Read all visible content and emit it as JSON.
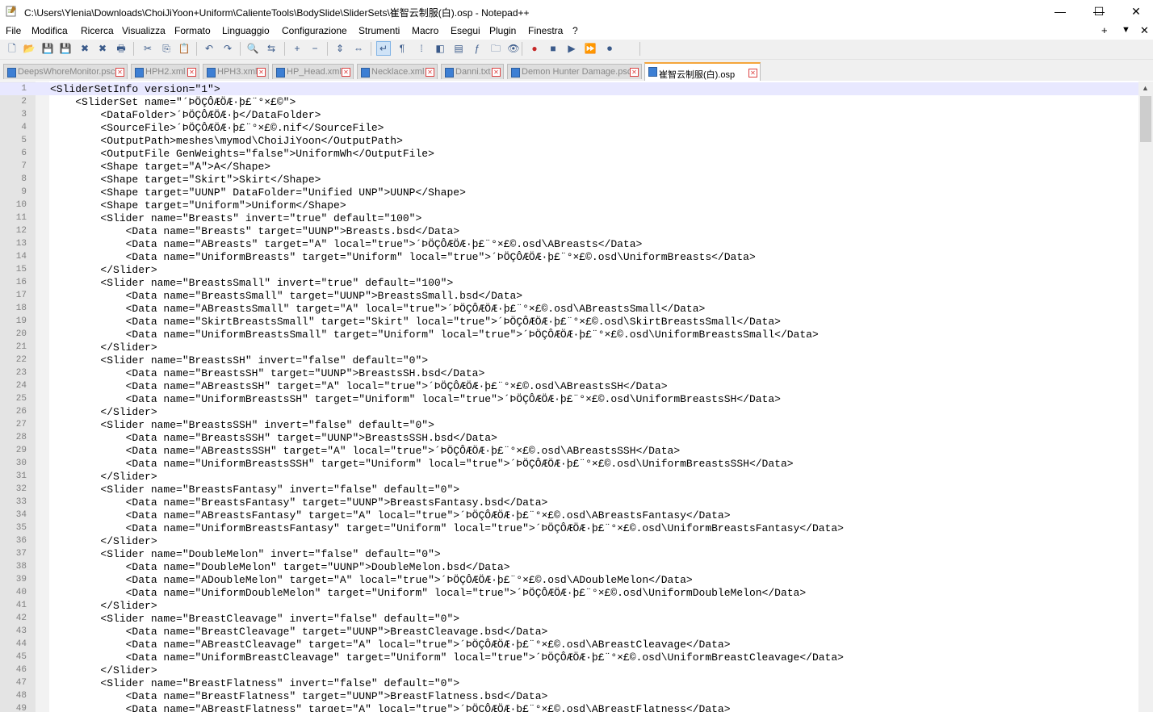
{
  "window": {
    "title": "C:\\Users\\Ylenia\\Downloads\\ChoiJiYoon+Uniform\\CalienteTools\\BodySlide\\SliderSets\\崔智云制服(白).osp - Notepad++",
    "min_label": "—",
    "max_label": "☐",
    "close_label": "✕"
  },
  "menu": {
    "items": [
      "File",
      "Modifica",
      "Ricerca",
      "Visualizza",
      "Formato",
      "Linguaggio",
      "Configurazione",
      "Strumenti",
      "Macro",
      "Esegui",
      "Plugin",
      "Finestra",
      "?"
    ],
    "right": [
      "+",
      "▼",
      "✕"
    ]
  },
  "toolbar": {
    "icons": [
      "new-file-icon",
      "open-file-icon",
      "save-icon",
      "save-all-icon",
      "close-icon",
      "close-all-icon",
      "print-icon",
      "cut-icon",
      "copy-icon",
      "paste-icon",
      "undo-icon",
      "redo-icon",
      "find-icon",
      "replace-icon",
      "zoom-in-icon",
      "zoom-out-icon",
      "sync-vertical-icon",
      "sync-horizontal-icon",
      "word-wrap-icon",
      "show-all-chars-icon",
      "indent-guide-icon",
      "language-icon",
      "doc-map-icon",
      "function-list-icon",
      "folder-workspace-icon",
      "monitoring-icon",
      "record-macro-icon",
      "stop-record-icon",
      "play-macro-icon",
      "run-macro-multiple-icon",
      "save-macro-icon"
    ],
    "glyphs": [
      "🗋",
      "📂",
      "💾",
      "💾",
      "✖",
      "✖",
      "🖶",
      "✂",
      "⎘",
      "📋",
      "↶",
      "↷",
      "🔍",
      "⇆",
      "+",
      "−",
      "⇕",
      "⇔",
      "↵",
      "¶",
      "⁞",
      "◧",
      "▤",
      "ƒ",
      "🗀",
      "👁",
      "●",
      "■",
      "▶",
      "⏩",
      "⏺"
    ]
  },
  "tabs": [
    {
      "label": "DeepsWhoreMonitor.psc",
      "active": false
    },
    {
      "label": "HPH2.xml",
      "active": false
    },
    {
      "label": "HPH3.xml",
      "active": false
    },
    {
      "label": "HP_Head.xml",
      "active": false
    },
    {
      "label": "Necklace.xml",
      "active": false
    },
    {
      "label": "Danni.txt",
      "active": false
    },
    {
      "label": "Demon Hunter Damage.psc",
      "active": false
    },
    {
      "label": "崔智云制服(白).osp",
      "active": true
    }
  ],
  "editor": {
    "current_line": 1,
    "lines": [
      {
        "n": "1",
        "text": "<SliderSetInfo version=\"1\">"
      },
      {
        "n": "2",
        "text": "    <SliderSet name=\"´ÞÖÇÔÆÖÆ·þ£¨°×£©\">"
      },
      {
        "n": "3",
        "text": "        <DataFolder>´ÞÖÇÔÆÖÆ·þ</DataFolder>"
      },
      {
        "n": "4",
        "text": "        <SourceFile>´ÞÖÇÔÆÖÆ·þ£¨°×£©.nif</SourceFile>"
      },
      {
        "n": "5",
        "text": "        <OutputPath>meshes\\mymod\\ChoiJiYoon</OutputPath>"
      },
      {
        "n": "6",
        "text": "        <OutputFile GenWeights=\"false\">UniformWh</OutputFile>"
      },
      {
        "n": "7",
        "text": "        <Shape target=\"A\">A</Shape>"
      },
      {
        "n": "8",
        "text": "        <Shape target=\"Skirt\">Skirt</Shape>"
      },
      {
        "n": "9",
        "text": "        <Shape target=\"UUNP\" DataFolder=\"Unified UNP\">UUNP</Shape>"
      },
      {
        "n": "10",
        "text": "        <Shape target=\"Uniform\">Uniform</Shape>"
      },
      {
        "n": "11",
        "text": "        <Slider name=\"Breasts\" invert=\"true\" default=\"100\">"
      },
      {
        "n": "12",
        "text": "            <Data name=\"Breasts\" target=\"UUNP\">Breasts.bsd</Data>"
      },
      {
        "n": "13",
        "text": "            <Data name=\"ABreasts\" target=\"A\" local=\"true\">´ÞÖÇÔÆÖÆ·þ£¨°×£©.osd\\ABreasts</Data>"
      },
      {
        "n": "14",
        "text": "            <Data name=\"UniformBreasts\" target=\"Uniform\" local=\"true\">´ÞÖÇÔÆÖÆ·þ£¨°×£©.osd\\UniformBreasts</Data>"
      },
      {
        "n": "15",
        "text": "        </Slider>"
      },
      {
        "n": "16",
        "text": "        <Slider name=\"BreastsSmall\" invert=\"true\" default=\"100\">"
      },
      {
        "n": "17",
        "text": "            <Data name=\"BreastsSmall\" target=\"UUNP\">BreastsSmall.bsd</Data>"
      },
      {
        "n": "18",
        "text": "            <Data name=\"ABreastsSmall\" target=\"A\" local=\"true\">´ÞÖÇÔÆÖÆ·þ£¨°×£©.osd\\ABreastsSmall</Data>"
      },
      {
        "n": "19",
        "text": "            <Data name=\"SkirtBreastsSmall\" target=\"Skirt\" local=\"true\">´ÞÖÇÔÆÖÆ·þ£¨°×£©.osd\\SkirtBreastsSmall</Data>"
      },
      {
        "n": "20",
        "text": "            <Data name=\"UniformBreastsSmall\" target=\"Uniform\" local=\"true\">´ÞÖÇÔÆÖÆ·þ£¨°×£©.osd\\UniformBreastsSmall</Data>"
      },
      {
        "n": "21",
        "text": "        </Slider>"
      },
      {
        "n": "22",
        "text": "        <Slider name=\"BreastsSH\" invert=\"false\" default=\"0\">"
      },
      {
        "n": "23",
        "text": "            <Data name=\"BreastsSH\" target=\"UUNP\">BreastsSH.bsd</Data>"
      },
      {
        "n": "24",
        "text": "            <Data name=\"ABreastsSH\" target=\"A\" local=\"true\">´ÞÖÇÔÆÖÆ·þ£¨°×£©.osd\\ABreastsSH</Data>"
      },
      {
        "n": "25",
        "text": "            <Data name=\"UniformBreastsSH\" target=\"Uniform\" local=\"true\">´ÞÖÇÔÆÖÆ·þ£¨°×£©.osd\\UniformBreastsSH</Data>"
      },
      {
        "n": "26",
        "text": "        </Slider>"
      },
      {
        "n": "27",
        "text": "        <Slider name=\"BreastsSSH\" invert=\"false\" default=\"0\">"
      },
      {
        "n": "28",
        "text": "            <Data name=\"BreastsSSH\" target=\"UUNP\">BreastsSSH.bsd</Data>"
      },
      {
        "n": "29",
        "text": "            <Data name=\"ABreastsSSH\" target=\"A\" local=\"true\">´ÞÖÇÔÆÖÆ·þ£¨°×£©.osd\\ABreastsSSH</Data>"
      },
      {
        "n": "30",
        "text": "            <Data name=\"UniformBreastsSSH\" target=\"Uniform\" local=\"true\">´ÞÖÇÔÆÖÆ·þ£¨°×£©.osd\\UniformBreastsSSH</Data>"
      },
      {
        "n": "31",
        "text": "        </Slider>"
      },
      {
        "n": "32",
        "text": "        <Slider name=\"BreastsFantasy\" invert=\"false\" default=\"0\">"
      },
      {
        "n": "33",
        "text": "            <Data name=\"BreastsFantasy\" target=\"UUNP\">BreastsFantasy.bsd</Data>"
      },
      {
        "n": "34",
        "text": "            <Data name=\"ABreastsFantasy\" target=\"A\" local=\"true\">´ÞÖÇÔÆÖÆ·þ£¨°×£©.osd\\ABreastsFantasy</Data>"
      },
      {
        "n": "35",
        "text": "            <Data name=\"UniformBreastsFantasy\" target=\"Uniform\" local=\"true\">´ÞÖÇÔÆÖÆ·þ£¨°×£©.osd\\UniformBreastsFantasy</Data>"
      },
      {
        "n": "36",
        "text": "        </Slider>"
      },
      {
        "n": "37",
        "text": "        <Slider name=\"DoubleMelon\" invert=\"false\" default=\"0\">"
      },
      {
        "n": "38",
        "text": "            <Data name=\"DoubleMelon\" target=\"UUNP\">DoubleMelon.bsd</Data>"
      },
      {
        "n": "39",
        "text": "            <Data name=\"ADoubleMelon\" target=\"A\" local=\"true\">´ÞÖÇÔÆÖÆ·þ£¨°×£©.osd\\ADoubleMelon</Data>"
      },
      {
        "n": "40",
        "text": "            <Data name=\"UniformDoubleMelon\" target=\"Uniform\" local=\"true\">´ÞÖÇÔÆÖÆ·þ£¨°×£©.osd\\UniformDoubleMelon</Data>"
      },
      {
        "n": "41",
        "text": "        </Slider>"
      },
      {
        "n": "42",
        "text": "        <Slider name=\"BreastCleavage\" invert=\"false\" default=\"0\">"
      },
      {
        "n": "43",
        "text": "            <Data name=\"BreastCleavage\" target=\"UUNP\">BreastCleavage.bsd</Data>"
      },
      {
        "n": "44",
        "text": "            <Data name=\"ABreastCleavage\" target=\"A\" local=\"true\">´ÞÖÇÔÆÖÆ·þ£¨°×£©.osd\\ABreastCleavage</Data>"
      },
      {
        "n": "45",
        "text": "            <Data name=\"UniformBreastCleavage\" target=\"Uniform\" local=\"true\">´ÞÖÇÔÆÖÆ·þ£¨°×£©.osd\\UniformBreastCleavage</Data>"
      },
      {
        "n": "46",
        "text": "        </Slider>"
      },
      {
        "n": "47",
        "text": "        <Slider name=\"BreastFlatness\" invert=\"false\" default=\"0\">"
      },
      {
        "n": "48",
        "text": "            <Data name=\"BreastFlatness\" target=\"UUNP\">BreastFlatness.bsd</Data>"
      },
      {
        "n": "49",
        "text": "            <Data name=\"ABreastFlatness\" target=\"A\" local=\"true\">´ÞÖÇÔÆÖÆ·þ£¨°×£©.osd\\ABreastFlatness</Data>"
      }
    ]
  },
  "colors": {
    "active_tab_accent": "#f4a53b",
    "current_line_bg": "#e8e8ff",
    "line_number_bg": "#e4e4e4"
  }
}
